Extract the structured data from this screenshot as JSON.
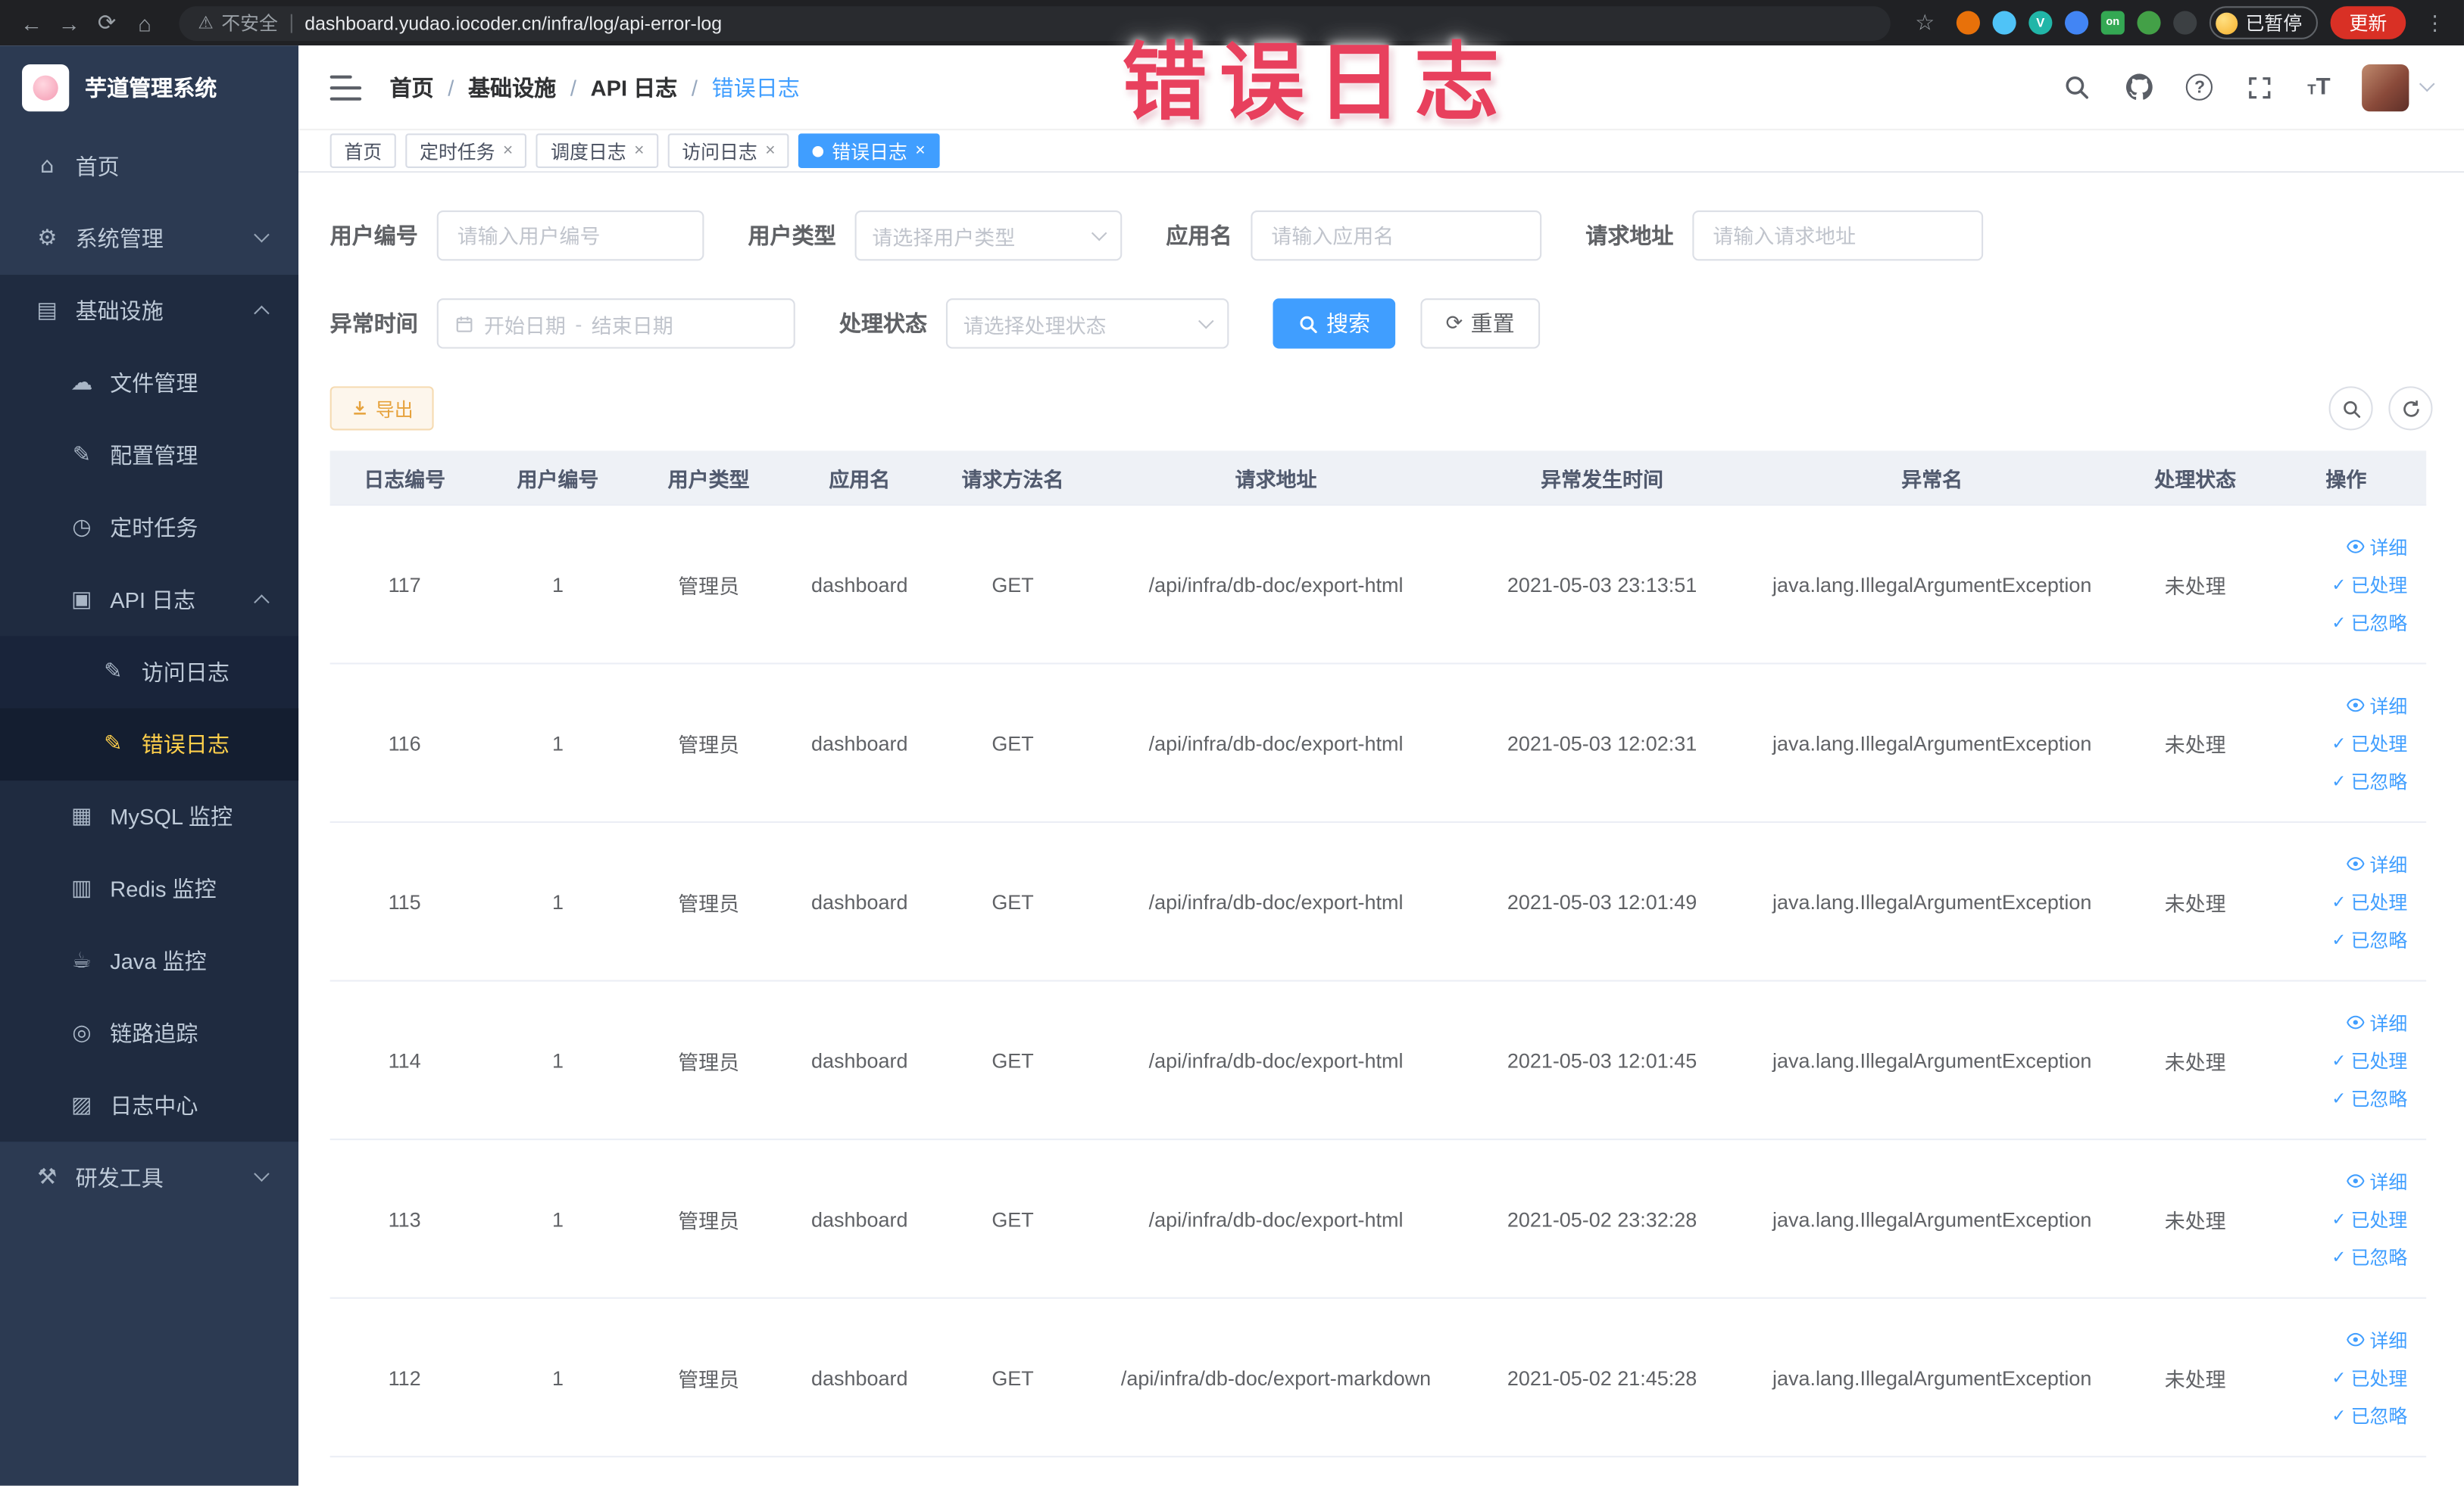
{
  "watermark": "错误日志",
  "colors": {
    "accent": "#409eff",
    "sidebar_active": "#ffd04b",
    "warning_button": "#e6a23c",
    "update_button": "#d93025",
    "watermark_red": "#e8405d"
  },
  "browser": {
    "security_label": "不安全",
    "url": "dashboard.yudao.iocoder.cn/infra/log/api-error-log",
    "extension_on_badge": "on",
    "paused_badge": "已暂停",
    "update_label": "更新"
  },
  "sidebar": {
    "app_title": "芋道管理系统",
    "items": {
      "home": "首页",
      "system": "系统管理",
      "infra": "基础设施",
      "file": "文件管理",
      "config": "配置管理",
      "job": "定时任务",
      "api_log": "API 日志",
      "access_log": "访问日志",
      "error_log": "错误日志",
      "mysql": "MySQL 监控",
      "redis": "Redis 监控",
      "java": "Java 监控",
      "trace": "链路追踪",
      "log_center": "日志中心",
      "dev_tools": "研发工具"
    }
  },
  "header": {
    "breadcrumb": [
      "首页",
      "基础设施",
      "API 日志",
      "错误日志"
    ],
    "separator": "/"
  },
  "tabs": [
    {
      "label": "首页"
    },
    {
      "label": "定时任务"
    },
    {
      "label": "调度日志"
    },
    {
      "label": "访问日志"
    },
    {
      "label": "错误日志"
    }
  ],
  "filters": {
    "user_id_label": "用户编号",
    "user_id_placeholder": "请输入用户编号",
    "user_type_label": "用户类型",
    "user_type_placeholder": "请选择用户类型",
    "app_name_label": "应用名",
    "app_name_placeholder": "请输入应用名",
    "request_url_label": "请求地址",
    "request_url_placeholder": "请输入请求地址",
    "exception_time_label": "异常时间",
    "date_start_placeholder": "开始日期",
    "date_separator": "-",
    "date_end_placeholder": "结束日期",
    "process_status_label": "处理状态",
    "process_status_placeholder": "请选择处理状态",
    "search_label": "搜索",
    "reset_label": "重置"
  },
  "toolbar": {
    "export_label": "导出"
  },
  "table": {
    "columns": [
      "日志编号",
      "用户编号",
      "用户类型",
      "应用名",
      "请求方法名",
      "请求地址",
      "异常发生时间",
      "异常名",
      "处理状态",
      "操作"
    ],
    "actions": {
      "detail": "详细",
      "processed": "已处理",
      "ignored": "已忽略"
    },
    "rows": [
      {
        "id": "117",
        "user_id": "1",
        "user_type": "管理员",
        "app": "dashboard",
        "method": "GET",
        "url": "/api/infra/db-doc/export-html",
        "time": "2021-05-03 23:13:51",
        "exception": "java.lang.IllegalArgumentException",
        "status": "未处理"
      },
      {
        "id": "116",
        "user_id": "1",
        "user_type": "管理员",
        "app": "dashboard",
        "method": "GET",
        "url": "/api/infra/db-doc/export-html",
        "time": "2021-05-03 12:02:31",
        "exception": "java.lang.IllegalArgumentException",
        "status": "未处理"
      },
      {
        "id": "115",
        "user_id": "1",
        "user_type": "管理员",
        "app": "dashboard",
        "method": "GET",
        "url": "/api/infra/db-doc/export-html",
        "time": "2021-05-03 12:01:49",
        "exception": "java.lang.IllegalArgumentException",
        "status": "未处理"
      },
      {
        "id": "114",
        "user_id": "1",
        "user_type": "管理员",
        "app": "dashboard",
        "method": "GET",
        "url": "/api/infra/db-doc/export-html",
        "time": "2021-05-03 12:01:45",
        "exception": "java.lang.IllegalArgumentException",
        "status": "未处理"
      },
      {
        "id": "113",
        "user_id": "1",
        "user_type": "管理员",
        "app": "dashboard",
        "method": "GET",
        "url": "/api/infra/db-doc/export-html",
        "time": "2021-05-02 23:32:28",
        "exception": "java.lang.IllegalArgumentException",
        "status": "未处理"
      },
      {
        "id": "112",
        "user_id": "1",
        "user_type": "管理员",
        "app": "dashboard",
        "method": "GET",
        "url": "/api/infra/db-doc/export-markdown",
        "time": "2021-05-02 21:45:28",
        "exception": "java.lang.IllegalArgumentException",
        "status": "未处理"
      }
    ]
  }
}
